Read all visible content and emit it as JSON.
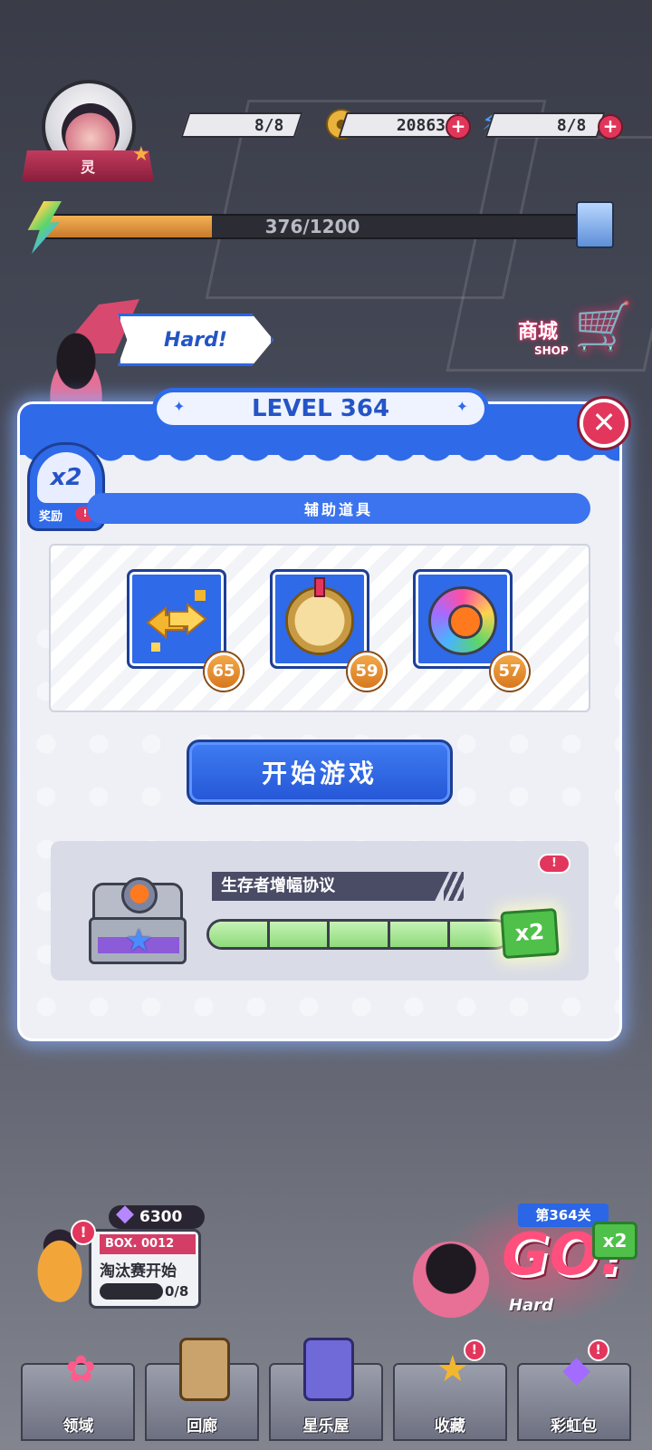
{
  "player": {
    "name": "灵",
    "resources": [
      {
        "id": "energy",
        "value": "8/8",
        "icon": "lightning-icon",
        "color": "#3f6fe0"
      },
      {
        "id": "coins",
        "value": "20863",
        "icon": "coin-icon",
        "color": "#e8b23c"
      },
      {
        "id": "stamina",
        "value": "8/8",
        "icon": "lightning-icon",
        "color": "#4aa0ff"
      }
    ],
    "xp": {
      "text": "376/1200",
      "progress": 0.313
    }
  },
  "shop": {
    "title": "商城",
    "subtitle": "SHOP"
  },
  "difficulty": "Hard!",
  "modal": {
    "level_title": "LEVEL 364",
    "reward_multiplier": "x2",
    "reward_label": "奖励",
    "reward_alert": "!",
    "section_title": "辅助道具",
    "items": [
      {
        "name": "swap-arrows-icon",
        "count": "65",
        "color": "#f3b62f"
      },
      {
        "name": "helmet-coin-icon",
        "count": "59",
        "color": "#e5c27a"
      },
      {
        "name": "color-orb-icon",
        "count": "57",
        "color": "#ff7a1f"
      }
    ],
    "start_button": "开始游戏",
    "protocol": {
      "title": "生存者增幅协议",
      "alert": "!",
      "segments_filled": 5,
      "multiplier": "x2"
    }
  },
  "box_widget": {
    "gems": "6300",
    "label": "BOX. 0012",
    "title": "淘汰赛开始",
    "progress": "0/8",
    "alert": "!"
  },
  "go_widget": {
    "stage": "第364关",
    "go": "GO!",
    "difficulty": "Hard",
    "multiplier": "x2"
  },
  "nav": [
    {
      "label": "领域",
      "icon": "domain-icon",
      "alert": false
    },
    {
      "label": "回廊",
      "icon": "gallery-icon",
      "alert": false
    },
    {
      "label": "星乐屋",
      "icon": "star-house-icon",
      "alert": false
    },
    {
      "label": "收藏",
      "icon": "star-icon",
      "alert": true
    },
    {
      "label": "彩虹包",
      "icon": "rainbow-pack-icon",
      "alert": true
    }
  ],
  "colors": {
    "primary_blue": "#2f6ae8",
    "alert_red": "#e2365c",
    "accent_green": "#4fc04a",
    "badge_orange": "#d8781f"
  }
}
